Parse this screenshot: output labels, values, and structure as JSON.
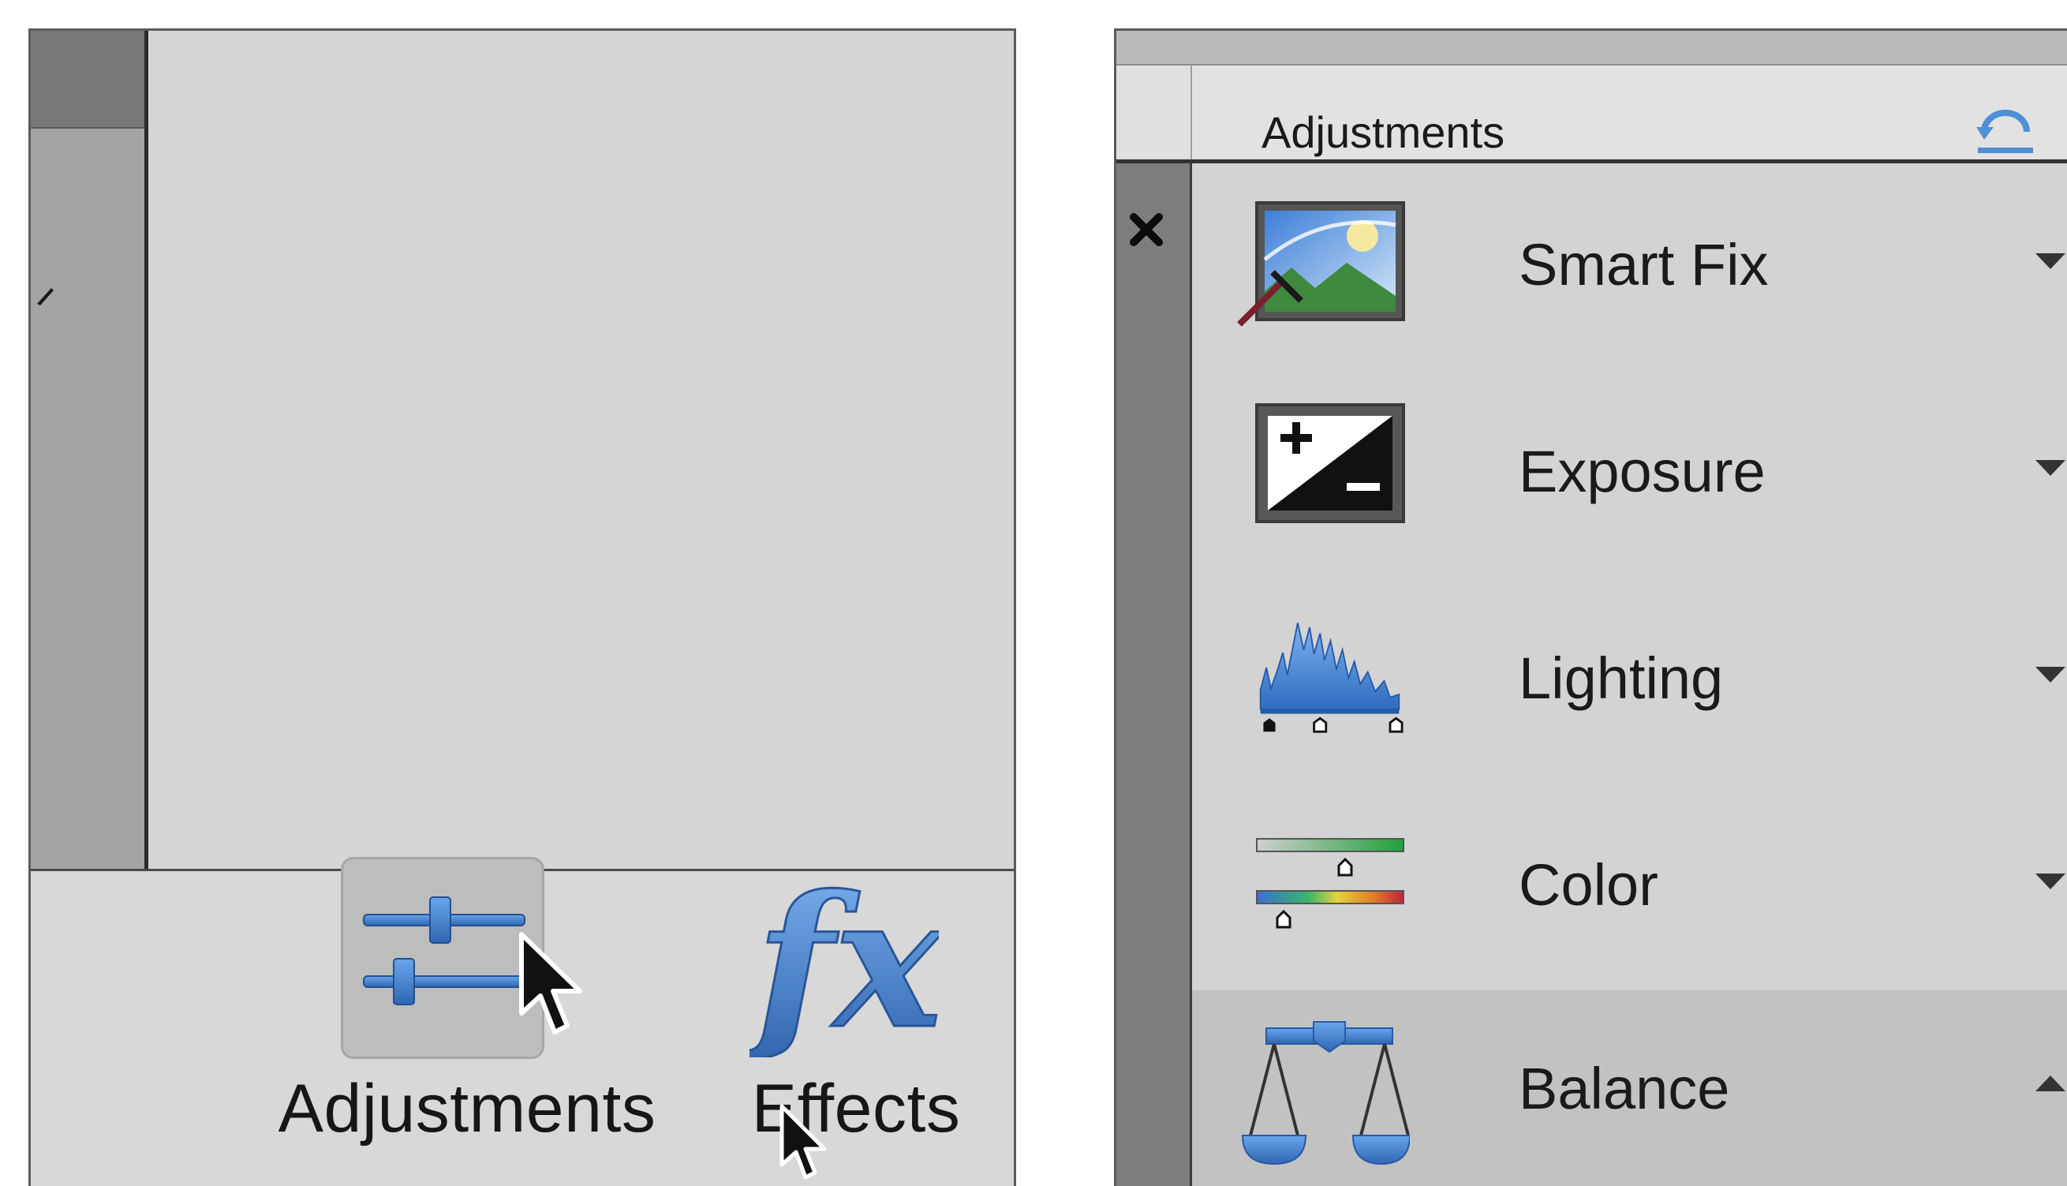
{
  "left_panel": {
    "bottom_bar": {
      "adjustments_button": {
        "label": "Adjustments",
        "icon": "sliders-icon"
      },
      "effects_button": {
        "label": "Effects",
        "icon_text": "fx",
        "icon": "fx-icon"
      }
    }
  },
  "right_panel": {
    "header": {
      "title": "Adjustments",
      "reset_icon": "reset-icon",
      "help_icon": "help-icon"
    },
    "close_icon": "close-icon",
    "items": [
      {
        "label": "Smart Fix",
        "icon": "smart-fix-icon",
        "expanded": false
      },
      {
        "label": "Exposure",
        "icon": "exposure-icon",
        "expanded": false
      },
      {
        "label": "Lighting",
        "icon": "lighting-icon",
        "expanded": false
      },
      {
        "label": "Color",
        "icon": "color-icon",
        "expanded": false
      },
      {
        "label": "Balance",
        "icon": "balance-icon",
        "expanded": true
      }
    ]
  },
  "colors": {
    "panel_bg": "#d4d4d4",
    "accent_blue": "#3f7fd0",
    "selected_row": "#c2c2c2"
  }
}
